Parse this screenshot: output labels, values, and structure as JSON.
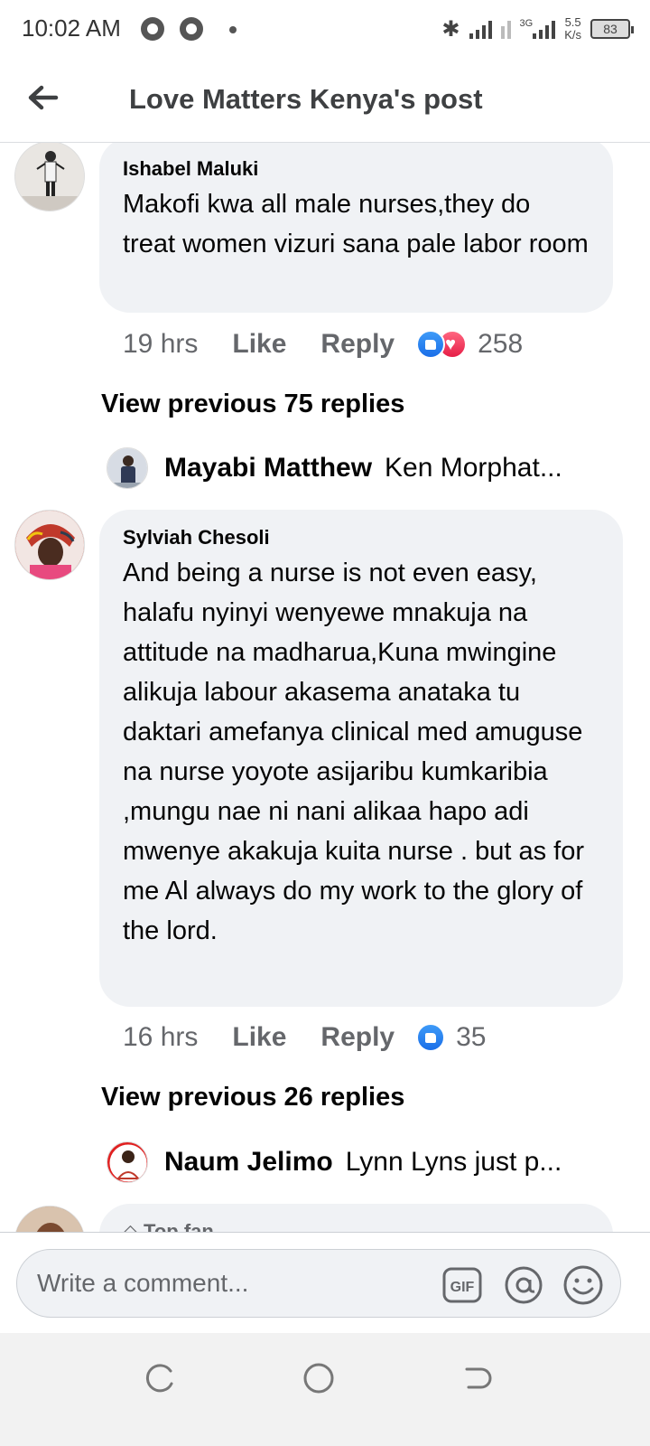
{
  "status_bar": {
    "time": "10:02 AM",
    "network_label": "3G",
    "speed_value": "5.5",
    "speed_unit": "K/s",
    "battery": "83"
  },
  "header": {
    "title": "Love Matters Kenya's post",
    "back_icon": "arrow-left-icon"
  },
  "comments": [
    {
      "author": "Ishabel Maluki",
      "text": "Makofi kwa all male nurses,they do treat women vizuri sana pale labor room",
      "time": "19 hrs",
      "like_label": "Like",
      "reply_label": "Reply",
      "reactions": [
        "like",
        "love"
      ],
      "reaction_count": "258",
      "view_previous": "View previous 75 replies",
      "reply_preview": {
        "name": "Mayabi Matthew",
        "text": "Ken Morphat..."
      }
    },
    {
      "author": "Sylviah Chesoli",
      "text": "And being a nurse is not even easy, halafu nyinyi wenyewe mnakuja na attitude na madharua,Kuna mwingine alikuja labour akasema anataka tu daktari amefanya clinical med amuguse na nurse yoyote asijaribu kumkaribia ,mungu nae ni nani alikaa hapo adi mwenye akakuja kuita nurse . but as for me Al always do my work to the glory of the lord.",
      "time": "16 hrs",
      "like_label": "Like",
      "reply_label": "Reply",
      "reactions": [
        "like"
      ],
      "reaction_count": "35",
      "view_previous": "View previous 26 replies",
      "reply_preview": {
        "name": "Naum Jelimo",
        "text": "Lynn Lyns just p..."
      }
    },
    {
      "badge": "Top fan"
    }
  ],
  "composer": {
    "placeholder": "Write a comment...",
    "icons": [
      "gif-icon",
      "mention-icon",
      "emoji-icon"
    ]
  },
  "nav_bar": {
    "icons": [
      "recent-apps-icon",
      "home-icon",
      "back-icon"
    ]
  },
  "colors": {
    "bubble_bg": "#f0f2f5",
    "secondary_text": "#65676b",
    "like_blue": "#1877f2",
    "love_red": "#f33e58"
  }
}
